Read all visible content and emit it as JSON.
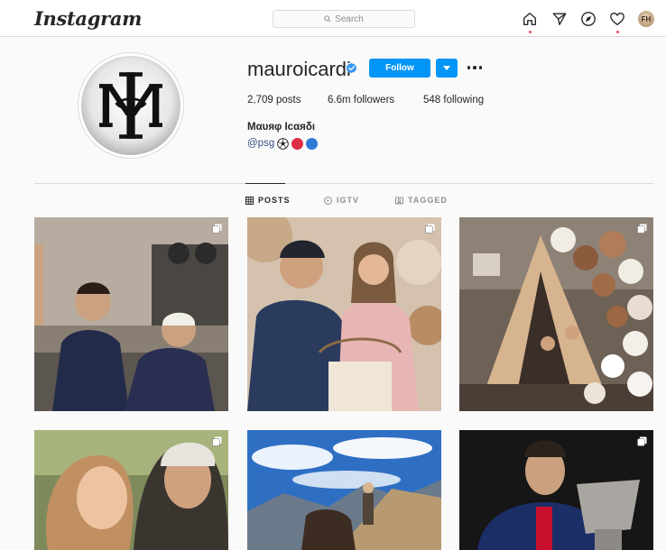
{
  "header": {
    "logo": "Instagram",
    "search_placeholder": "Search",
    "nav_icons": [
      "home-icon",
      "direct-icon",
      "explore-icon",
      "activity-heart-icon"
    ],
    "avatar_initials": "FH"
  },
  "profile": {
    "username": "mauroicardi",
    "verified": true,
    "follow_label": "Follow",
    "stats": {
      "posts_count": "2,709",
      "posts_label": "posts",
      "followers_count": "6.6m",
      "followers_label": "followers",
      "following_count": "548",
      "following_label": "following"
    },
    "full_name": "Μαυяφ Ιcαяδι",
    "bio_link": "@psg",
    "bio_emojis": [
      "soccer-ball-icon",
      "red-circle-icon",
      "blue-circle-icon"
    ]
  },
  "tabs": [
    {
      "label": "POSTS",
      "icon": "grid-icon",
      "active": true
    },
    {
      "label": "IGTV",
      "icon": "igtv-icon",
      "active": false
    },
    {
      "label": "TAGGED",
      "icon": "tagged-icon",
      "active": false
    }
  ],
  "colors": {
    "accent": "#0095f6",
    "link": "#385185",
    "notification": "#ed4956",
    "verified": "#3897f0"
  }
}
